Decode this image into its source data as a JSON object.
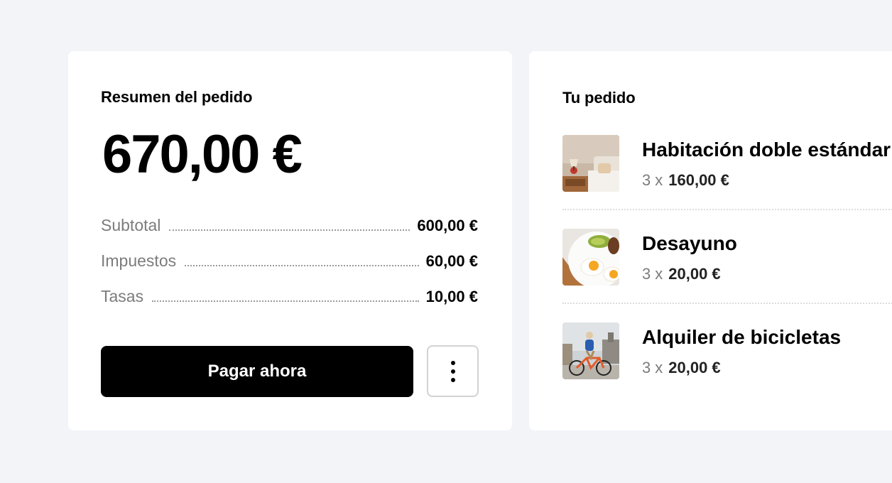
{
  "summary": {
    "title": "Resumen del pedido",
    "total": "670,00 €",
    "rows": [
      {
        "label": "Subtotal",
        "value": "600,00 €"
      },
      {
        "label": "Impuestos",
        "value": "60,00 €"
      },
      {
        "label": "Tasas",
        "value": "10,00 €"
      }
    ],
    "pay_label": "Pagar ahora"
  },
  "order": {
    "title": "Tu pedido",
    "items": [
      {
        "name": "Habitación doble estándar",
        "qty": "3",
        "times": "x",
        "price": "160,00 €",
        "icon": "hotel-room-photo"
      },
      {
        "name": "Desayuno",
        "qty": "3",
        "times": "x",
        "price": "20,00 €",
        "icon": "breakfast-photo"
      },
      {
        "name": "Alquiler de bicicletas",
        "qty": "3",
        "times": "x",
        "price": "20,00 €",
        "icon": "bicycle-photo"
      }
    ]
  },
  "colors": {
    "background": "#f3f4f8",
    "card": "#ffffff",
    "primary_button": "#000000",
    "muted_text": "#7c7c7c"
  }
}
